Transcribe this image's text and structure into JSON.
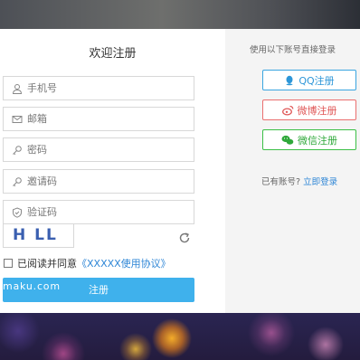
{
  "form": {
    "title": "欢迎注册",
    "fields": [
      {
        "placeholder": "手机号",
        "icon": "user-icon"
      },
      {
        "placeholder": "邮箱",
        "icon": "mail-icon"
      },
      {
        "placeholder": "密码",
        "icon": "key-icon"
      },
      {
        "placeholder": "邀请码",
        "icon": "key-icon"
      },
      {
        "placeholder": "验证码",
        "icon": "shield-icon"
      }
    ],
    "captcha_text": "H LL",
    "agree_label": "已阅读并同意",
    "agree_link": "《XXXXX使用协议》",
    "submit_label": "注册",
    "watermark": "maku.com"
  },
  "social": {
    "hint": "使用以下账号直接登录",
    "qq_label": "QQ注册",
    "weibo_label": "微博注册",
    "wechat_label": "微信注册",
    "colors": {
      "qq": "#2d96d8",
      "weibo": "#e05858",
      "wechat": "#2fa83a"
    }
  },
  "login": {
    "prompt": "已有账号?",
    "link": "立即登录"
  },
  "colors": {
    "accent": "#3fb1ec",
    "link": "#2e86d6"
  }
}
